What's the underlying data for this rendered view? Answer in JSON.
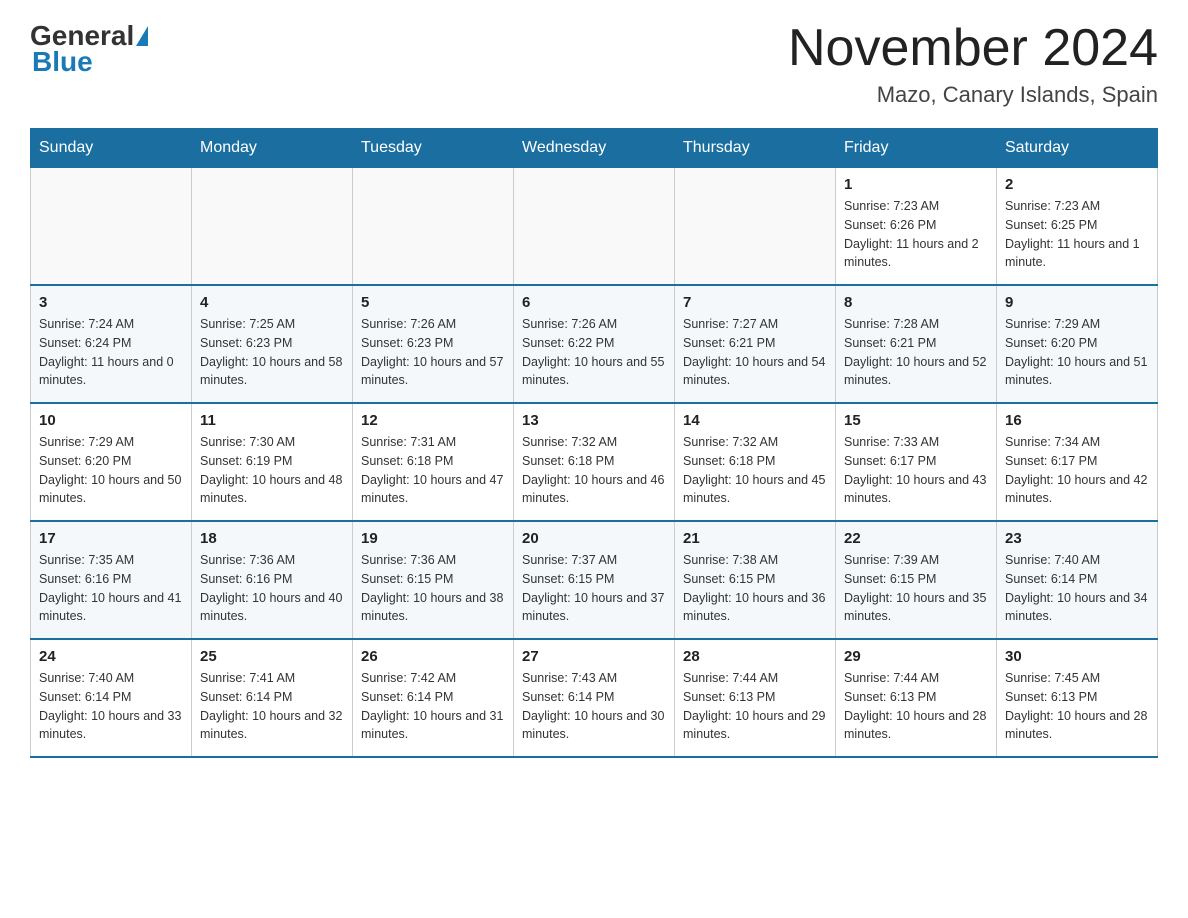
{
  "header": {
    "logo": {
      "general": "General",
      "blue": "Blue"
    },
    "title": "November 2024",
    "location": "Mazo, Canary Islands, Spain"
  },
  "calendar": {
    "days_of_week": [
      "Sunday",
      "Monday",
      "Tuesday",
      "Wednesday",
      "Thursday",
      "Friday",
      "Saturday"
    ],
    "weeks": [
      {
        "days": [
          {
            "number": "",
            "info": ""
          },
          {
            "number": "",
            "info": ""
          },
          {
            "number": "",
            "info": ""
          },
          {
            "number": "",
            "info": ""
          },
          {
            "number": "",
            "info": ""
          },
          {
            "number": "1",
            "info": "Sunrise: 7:23 AM\nSunset: 6:26 PM\nDaylight: 11 hours and 2 minutes."
          },
          {
            "number": "2",
            "info": "Sunrise: 7:23 AM\nSunset: 6:25 PM\nDaylight: 11 hours and 1 minute."
          }
        ]
      },
      {
        "days": [
          {
            "number": "3",
            "info": "Sunrise: 7:24 AM\nSunset: 6:24 PM\nDaylight: 11 hours and 0 minutes."
          },
          {
            "number": "4",
            "info": "Sunrise: 7:25 AM\nSunset: 6:23 PM\nDaylight: 10 hours and 58 minutes."
          },
          {
            "number": "5",
            "info": "Sunrise: 7:26 AM\nSunset: 6:23 PM\nDaylight: 10 hours and 57 minutes."
          },
          {
            "number": "6",
            "info": "Sunrise: 7:26 AM\nSunset: 6:22 PM\nDaylight: 10 hours and 55 minutes."
          },
          {
            "number": "7",
            "info": "Sunrise: 7:27 AM\nSunset: 6:21 PM\nDaylight: 10 hours and 54 minutes."
          },
          {
            "number": "8",
            "info": "Sunrise: 7:28 AM\nSunset: 6:21 PM\nDaylight: 10 hours and 52 minutes."
          },
          {
            "number": "9",
            "info": "Sunrise: 7:29 AM\nSunset: 6:20 PM\nDaylight: 10 hours and 51 minutes."
          }
        ]
      },
      {
        "days": [
          {
            "number": "10",
            "info": "Sunrise: 7:29 AM\nSunset: 6:20 PM\nDaylight: 10 hours and 50 minutes."
          },
          {
            "number": "11",
            "info": "Sunrise: 7:30 AM\nSunset: 6:19 PM\nDaylight: 10 hours and 48 minutes."
          },
          {
            "number": "12",
            "info": "Sunrise: 7:31 AM\nSunset: 6:18 PM\nDaylight: 10 hours and 47 minutes."
          },
          {
            "number": "13",
            "info": "Sunrise: 7:32 AM\nSunset: 6:18 PM\nDaylight: 10 hours and 46 minutes."
          },
          {
            "number": "14",
            "info": "Sunrise: 7:32 AM\nSunset: 6:18 PM\nDaylight: 10 hours and 45 minutes."
          },
          {
            "number": "15",
            "info": "Sunrise: 7:33 AM\nSunset: 6:17 PM\nDaylight: 10 hours and 43 minutes."
          },
          {
            "number": "16",
            "info": "Sunrise: 7:34 AM\nSunset: 6:17 PM\nDaylight: 10 hours and 42 minutes."
          }
        ]
      },
      {
        "days": [
          {
            "number": "17",
            "info": "Sunrise: 7:35 AM\nSunset: 6:16 PM\nDaylight: 10 hours and 41 minutes."
          },
          {
            "number": "18",
            "info": "Sunrise: 7:36 AM\nSunset: 6:16 PM\nDaylight: 10 hours and 40 minutes."
          },
          {
            "number": "19",
            "info": "Sunrise: 7:36 AM\nSunset: 6:15 PM\nDaylight: 10 hours and 38 minutes."
          },
          {
            "number": "20",
            "info": "Sunrise: 7:37 AM\nSunset: 6:15 PM\nDaylight: 10 hours and 37 minutes."
          },
          {
            "number": "21",
            "info": "Sunrise: 7:38 AM\nSunset: 6:15 PM\nDaylight: 10 hours and 36 minutes."
          },
          {
            "number": "22",
            "info": "Sunrise: 7:39 AM\nSunset: 6:15 PM\nDaylight: 10 hours and 35 minutes."
          },
          {
            "number": "23",
            "info": "Sunrise: 7:40 AM\nSunset: 6:14 PM\nDaylight: 10 hours and 34 minutes."
          }
        ]
      },
      {
        "days": [
          {
            "number": "24",
            "info": "Sunrise: 7:40 AM\nSunset: 6:14 PM\nDaylight: 10 hours and 33 minutes."
          },
          {
            "number": "25",
            "info": "Sunrise: 7:41 AM\nSunset: 6:14 PM\nDaylight: 10 hours and 32 minutes."
          },
          {
            "number": "26",
            "info": "Sunrise: 7:42 AM\nSunset: 6:14 PM\nDaylight: 10 hours and 31 minutes."
          },
          {
            "number": "27",
            "info": "Sunrise: 7:43 AM\nSunset: 6:14 PM\nDaylight: 10 hours and 30 minutes."
          },
          {
            "number": "28",
            "info": "Sunrise: 7:44 AM\nSunset: 6:13 PM\nDaylight: 10 hours and 29 minutes."
          },
          {
            "number": "29",
            "info": "Sunrise: 7:44 AM\nSunset: 6:13 PM\nDaylight: 10 hours and 28 minutes."
          },
          {
            "number": "30",
            "info": "Sunrise: 7:45 AM\nSunset: 6:13 PM\nDaylight: 10 hours and 28 minutes."
          }
        ]
      }
    ]
  }
}
